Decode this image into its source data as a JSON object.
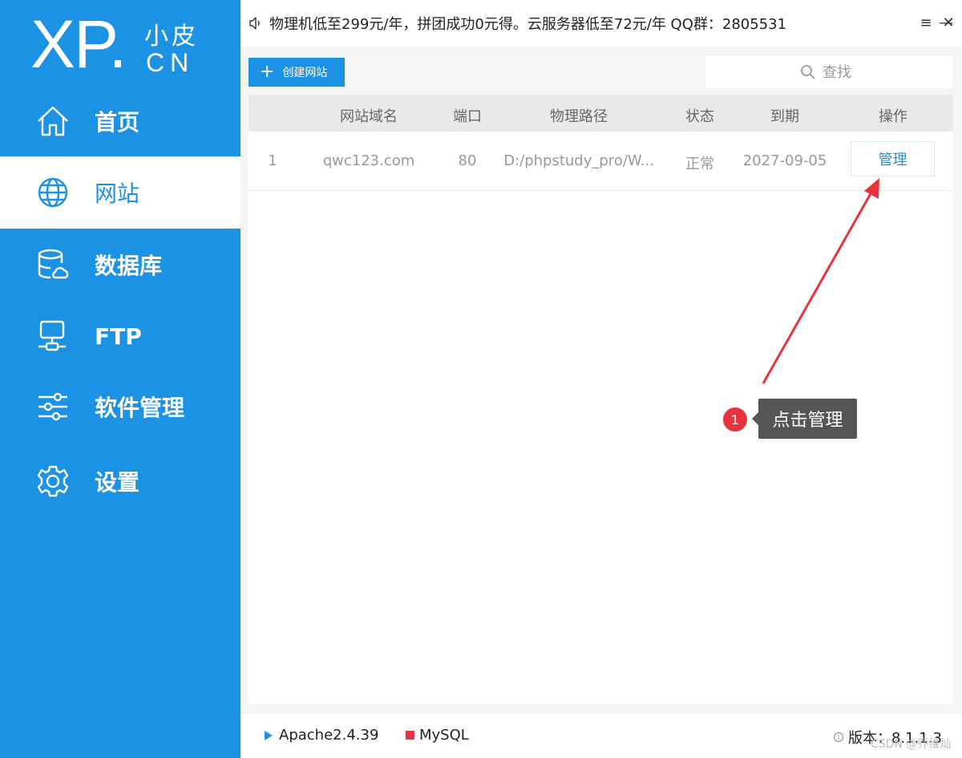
{
  "logo": {
    "xp": "XP.",
    "cn_top": "小皮",
    "cn_bottom": "CN"
  },
  "sidebar": {
    "items": [
      {
        "label": "首页",
        "icon": "home-icon",
        "active": false
      },
      {
        "label": "网站",
        "icon": "globe-icon",
        "active": true
      },
      {
        "label": "数据库",
        "icon": "database-icon",
        "active": false
      },
      {
        "label": "FTP",
        "icon": "ftp-icon",
        "active": false
      },
      {
        "label": "软件管理",
        "icon": "sliders-icon",
        "active": false
      },
      {
        "label": "设置",
        "icon": "gear-icon",
        "active": false
      }
    ]
  },
  "topbar": {
    "notice": "物理机低至299元/年，拼团成功0元得。云服务器低至72元/年 QQ群：2805531",
    "menu_icon": "≡",
    "minimize_icon": "—",
    "close_icon": "✕"
  },
  "toolbar": {
    "create_label": "创建网站",
    "search_placeholder": "查找"
  },
  "table": {
    "columns": [
      "网站域名",
      "端口",
      "物理路径",
      "状态",
      "到期",
      "操作"
    ],
    "rows": [
      {
        "index": "1",
        "domain": "qwc123.com",
        "port": "80",
        "path": "D:/phpstudy_pro/W...",
        "status": "正常",
        "expiry": "2027-09-05",
        "action": "管理"
      }
    ]
  },
  "annotation": {
    "badge": "1",
    "text": "点击管理",
    "color": "#e8333c"
  },
  "footer": {
    "apache": "Apache2.4.39",
    "mysql": "MySQL",
    "version": "版本：8.1.1.3"
  },
  "watermark": "CSDN @乔维灿",
  "colors": {
    "accent": "#1c92e5",
    "alert": "#e8333c",
    "tooltip_bg": "#555555"
  }
}
